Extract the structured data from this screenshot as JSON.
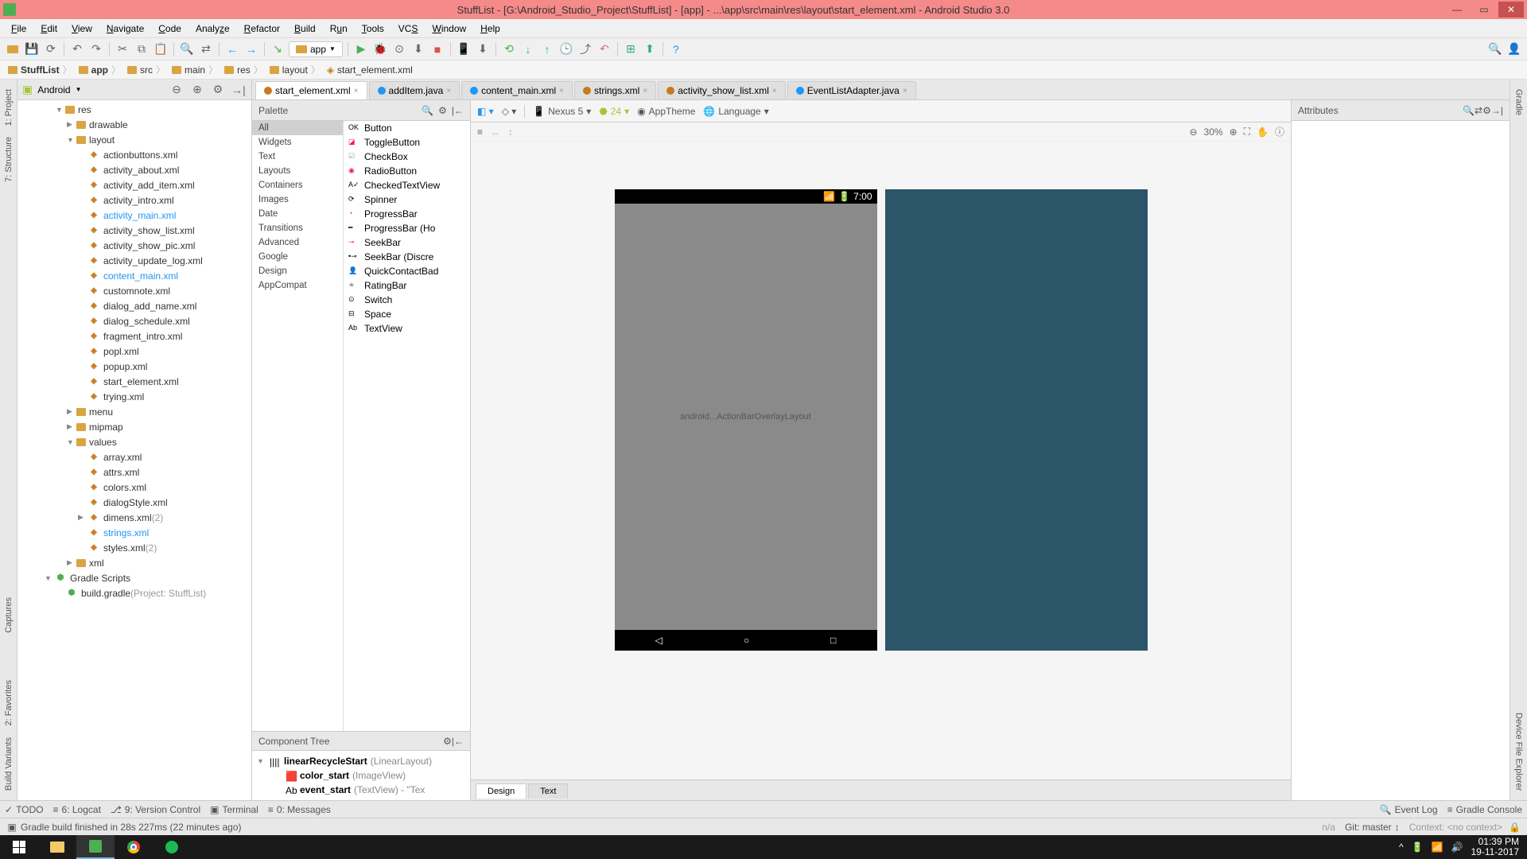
{
  "titlebar": {
    "text": "StuffList - [G:\\Android_Studio_Project\\StuffList] - [app] - ...\\app\\src\\main\\res\\layout\\start_element.xml - Android Studio 3.0"
  },
  "menu": [
    "File",
    "Edit",
    "View",
    "Navigate",
    "Code",
    "Analyze",
    "Refactor",
    "Build",
    "Run",
    "Tools",
    "VCS",
    "Window",
    "Help"
  ],
  "toolbar": {
    "module": "app"
  },
  "breadcrumb": [
    "StuffList",
    "app",
    "src",
    "main",
    "res",
    "layout",
    "start_element.xml"
  ],
  "project_header": {
    "view": "Android"
  },
  "tree": [
    {
      "depth": 3,
      "arrow": "▼",
      "type": "folder",
      "label": "res"
    },
    {
      "depth": 4,
      "arrow": "▶",
      "type": "folder",
      "label": "drawable"
    },
    {
      "depth": 4,
      "arrow": "▼",
      "type": "folder",
      "label": "layout"
    },
    {
      "depth": 5,
      "arrow": "",
      "type": "xml",
      "label": "actionbuttons.xml"
    },
    {
      "depth": 5,
      "arrow": "",
      "type": "xml",
      "label": "activity_about.xml"
    },
    {
      "depth": 5,
      "arrow": "",
      "type": "xml",
      "label": "activity_add_item.xml"
    },
    {
      "depth": 5,
      "arrow": "",
      "type": "xml",
      "label": "activity_intro.xml"
    },
    {
      "depth": 5,
      "arrow": "",
      "type": "xml",
      "label": "activity_main.xml",
      "blue": true
    },
    {
      "depth": 5,
      "arrow": "",
      "type": "xml",
      "label": "activity_show_list.xml"
    },
    {
      "depth": 5,
      "arrow": "",
      "type": "xml",
      "label": "activity_show_pic.xml"
    },
    {
      "depth": 5,
      "arrow": "",
      "type": "xml",
      "label": "activity_update_log.xml"
    },
    {
      "depth": 5,
      "arrow": "",
      "type": "xml",
      "label": "content_main.xml",
      "blue": true
    },
    {
      "depth": 5,
      "arrow": "",
      "type": "xml",
      "label": "customnote.xml"
    },
    {
      "depth": 5,
      "arrow": "",
      "type": "xml",
      "label": "dialog_add_name.xml"
    },
    {
      "depth": 5,
      "arrow": "",
      "type": "xml",
      "label": "dialog_schedule.xml"
    },
    {
      "depth": 5,
      "arrow": "",
      "type": "xml",
      "label": "fragment_intro.xml"
    },
    {
      "depth": 5,
      "arrow": "",
      "type": "xml",
      "label": "popl.xml"
    },
    {
      "depth": 5,
      "arrow": "",
      "type": "xml",
      "label": "popup.xml"
    },
    {
      "depth": 5,
      "arrow": "",
      "type": "xml",
      "label": "start_element.xml"
    },
    {
      "depth": 5,
      "arrow": "",
      "type": "xml",
      "label": "trying.xml"
    },
    {
      "depth": 4,
      "arrow": "▶",
      "type": "folder",
      "label": "menu"
    },
    {
      "depth": 4,
      "arrow": "▶",
      "type": "folder",
      "label": "mipmap"
    },
    {
      "depth": 4,
      "arrow": "▼",
      "type": "folder",
      "label": "values"
    },
    {
      "depth": 5,
      "arrow": "",
      "type": "xml",
      "label": "array.xml"
    },
    {
      "depth": 5,
      "arrow": "",
      "type": "xml",
      "label": "attrs.xml"
    },
    {
      "depth": 5,
      "arrow": "",
      "type": "xml",
      "label": "colors.xml"
    },
    {
      "depth": 5,
      "arrow": "",
      "type": "xml",
      "label": "dialogStyle.xml"
    },
    {
      "depth": 5,
      "arrow": "▶",
      "type": "xml",
      "label": "dimens.xml",
      "extra": "(2)"
    },
    {
      "depth": 5,
      "arrow": "",
      "type": "xml",
      "label": "strings.xml",
      "blue": true
    },
    {
      "depth": 5,
      "arrow": "",
      "type": "xml",
      "label": "styles.xml",
      "extra": "(2)",
      "highlightsel": true
    },
    {
      "depth": 4,
      "arrow": "▶",
      "type": "folder",
      "label": "xml"
    },
    {
      "depth": 2,
      "arrow": "▼",
      "type": "gradle",
      "label": "Gradle Scripts"
    },
    {
      "depth": 3,
      "arrow": "",
      "type": "gradle-file",
      "label": "build.gradle",
      "extra": "(Project: StuffList)"
    }
  ],
  "editor_tabs": [
    {
      "label": "start_element.xml",
      "active": true,
      "color": "#c77a1e"
    },
    {
      "label": "addItem.java",
      "color": "#2196f3"
    },
    {
      "label": "content_main.xml",
      "color": "#2196f3"
    },
    {
      "label": "strings.xml",
      "color": "#c77a1e"
    },
    {
      "label": "activity_show_list.xml",
      "color": "#c77a1e"
    },
    {
      "label": "EventListAdapter.java",
      "color": "#2196f3"
    }
  ],
  "palette": {
    "title": "Palette",
    "categories": [
      "All",
      "Widgets",
      "Text",
      "Layouts",
      "Containers",
      "Images",
      "Date",
      "Transitions",
      "Advanced",
      "Google",
      "Design",
      "AppCompat"
    ],
    "selected_cat": "All",
    "items": [
      "Button",
      "ToggleButton",
      "CheckBox",
      "RadioButton",
      "CheckedTextView",
      "Spinner",
      "ProgressBar",
      "ProgressBar (Horizontal)",
      "SeekBar",
      "SeekBar (Discrete)",
      "QuickContactBadge",
      "RatingBar",
      "Switch",
      "Space",
      "TextView"
    ]
  },
  "component_tree": {
    "title": "Component Tree",
    "rows": [
      {
        "depth": 0,
        "arrow": "▼",
        "name": "linearRecycleStart",
        "type": "(LinearLayout)"
      },
      {
        "depth": 1,
        "arrow": "",
        "name": "color_start",
        "type": "(ImageView)"
      },
      {
        "depth": 1,
        "arrow": "",
        "name": "event_start",
        "type": "(TextView)",
        "extra": " - \"Tex"
      }
    ]
  },
  "canvas_toolbar": {
    "device": "Nexus 5",
    "api": "24",
    "theme": "AppTheme",
    "lang": "Language",
    "zoom": "30%"
  },
  "device": {
    "time": "7:00",
    "overlay": "android...ActionBarOverlayLayout"
  },
  "design_tabs": [
    "Design",
    "Text"
  ],
  "attributes": {
    "title": "Attributes"
  },
  "bottom_tools": [
    "TODO",
    "6: Logcat",
    "9: Version Control",
    "Terminal",
    "0: Messages"
  ],
  "bottom_right": [
    "Event Log",
    "Gradle Console"
  ],
  "left_strip_top": [
    "1: Project",
    "7: Structure"
  ],
  "left_strip_bottom": [
    "Captures"
  ],
  "left_strip2": [
    "2: Favorites",
    "Build Variants"
  ],
  "right_strip": [
    "Gradle",
    "Device File Explorer"
  ],
  "statusbar": {
    "msg": "Gradle build finished in 28s 227ms (22 minutes ago)",
    "na": "n/a",
    "git": "Git: master",
    "context": "Context: <no context>"
  },
  "taskbar": {
    "time": "01:39 PM",
    "date": "19-11-2017"
  }
}
